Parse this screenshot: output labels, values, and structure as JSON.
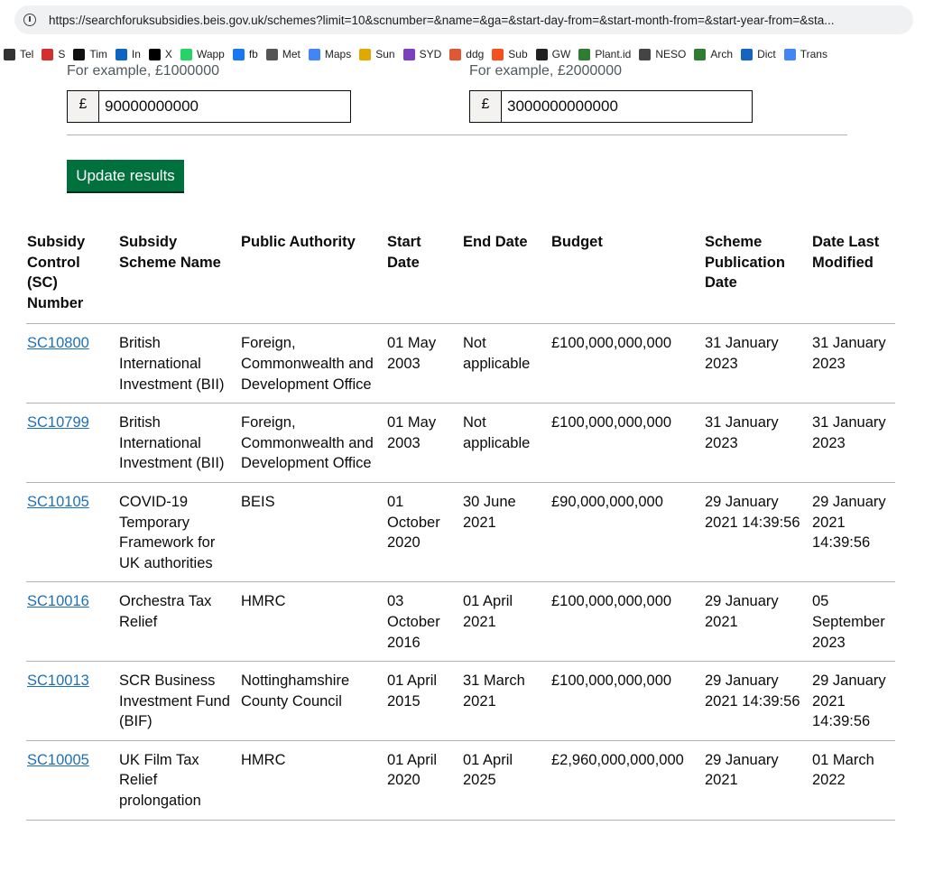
{
  "browser": {
    "url": "https://searchforuksubsidies.beis.gov.uk/schemes?limit=10&scnumber=&name=&ga=&start-day-from=&start-month-from=&start-year-from=&sta...",
    "bookmarks": [
      {
        "label": "Tel",
        "icon": "diamond-icon",
        "color": "#333333"
      },
      {
        "label": "S",
        "icon": "s-logo-icon",
        "color": "#d32f2f"
      },
      {
        "label": "Tim",
        "icon": "t-logo-icon",
        "color": "#111111"
      },
      {
        "label": "In",
        "icon": "linkedin-icon",
        "color": "#0a66c2"
      },
      {
        "label": "X",
        "icon": "x-logo-icon",
        "color": "#000000"
      },
      {
        "label": "Wapp",
        "icon": "whatsapp-icon",
        "color": "#25d366"
      },
      {
        "label": "fb",
        "icon": "facebook-icon",
        "color": "#1877f2"
      },
      {
        "label": "Met",
        "icon": "met-icon",
        "color": "#555555"
      },
      {
        "label": "Maps",
        "icon": "google-icon",
        "color": "#4285f4"
      },
      {
        "label": "Sun",
        "icon": "sun-icon",
        "color": "#e0a800"
      },
      {
        "label": "SYD",
        "icon": "syd-icon",
        "color": "#7b3fbf"
      },
      {
        "label": "ddg",
        "icon": "duckduckgo-icon",
        "color": "#de5833"
      },
      {
        "label": "Sub",
        "icon": "sub-icon",
        "color": "#f4511e"
      },
      {
        "label": "GW",
        "icon": "globe-icon",
        "color": "#222222"
      },
      {
        "label": "Plant.id",
        "icon": "leaf-icon",
        "color": "#2e7d32"
      },
      {
        "label": "NESO",
        "icon": "bookmark-icon",
        "color": "#444444"
      },
      {
        "label": "Arch",
        "icon": "archive-icon",
        "color": "#2e7d32"
      },
      {
        "label": "Dict",
        "icon": "dict-icon",
        "color": "#1565c0"
      },
      {
        "label": "Trans",
        "icon": "translate-icon",
        "color": "#4285f4"
      }
    ]
  },
  "filters": {
    "min_hint": "For example, £1000000",
    "max_hint": "For example, £2000000",
    "currency_symbol": "£",
    "min_value": "90000000000",
    "max_value": "3000000000000",
    "update_button": "Update results"
  },
  "table": {
    "headers": [
      "Subsidy Control (SC) Number",
      "Subsidy Scheme Name",
      "Public Authority",
      "Start Date",
      "End Date",
      "Budget",
      "Scheme Publication Date",
      "Date Last Modified"
    ],
    "rows": [
      {
        "sc": "SC10800",
        "name": "British International Investment (BII)",
        "authority": "Foreign, Commonwealth and Development Office",
        "start": "01 May 2003",
        "end": "Not applicable",
        "budget": "£100,000,000,000",
        "published": "31 January 2023",
        "modified": "31 January 2023"
      },
      {
        "sc": "SC10799",
        "name": "British International Investment (BII)",
        "authority": "Foreign, Commonwealth and Development Office",
        "start": "01 May 2003",
        "end": "Not applicable",
        "budget": "£100,000,000,000",
        "published": "31 January 2023",
        "modified": "31 January 2023"
      },
      {
        "sc": "SC10105",
        "name": "COVID-19 Temporary Framework for UK authorities",
        "authority": "BEIS",
        "start": "01 October 2020",
        "end": "30 June 2021",
        "budget": "£90,000,000,000",
        "published": "29 January 2021 14:39:56",
        "modified": "29 January 2021 14:39:56"
      },
      {
        "sc": "SC10016",
        "name": "Orchestra Tax Relief",
        "authority": "HMRC",
        "start": "03 October 2016",
        "end": "01 April 2021",
        "budget": "£100,000,000,000",
        "published": "29 January 2021",
        "modified": "05 September 2023"
      },
      {
        "sc": "SC10013",
        "name": "SCR Business Investment Fund (BIF)",
        "authority": "Nottinghamshire County Council",
        "start": "01 April 2015",
        "end": "31 March 2021",
        "budget": "£100,000,000,000",
        "published": "29 January 2021 14:39:56",
        "modified": "29 January 2021 14:39:56"
      },
      {
        "sc": "SC10005",
        "name": "UK Film Tax Relief prolongation",
        "authority": "HMRC",
        "start": "01 April 2020",
        "end": "01 April 2025",
        "budget": "£2,960,000,000,000",
        "published": "29 January 2021",
        "modified": "01 March 2022"
      }
    ]
  }
}
